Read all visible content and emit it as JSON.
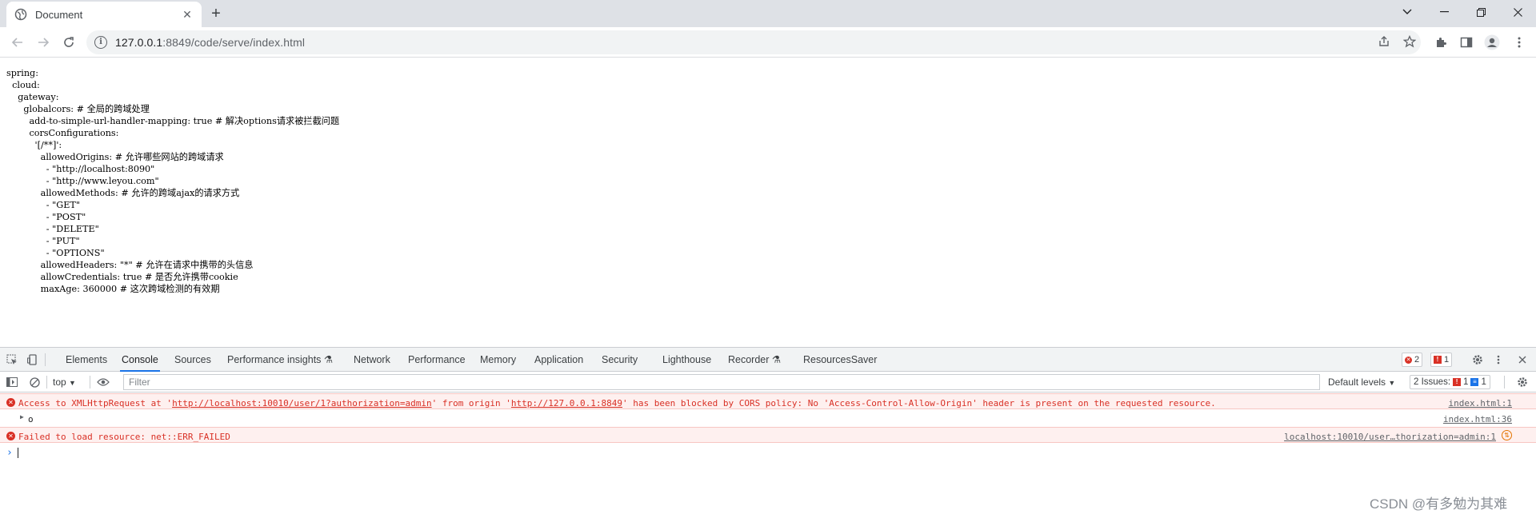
{
  "browser": {
    "tab_title": "Document",
    "new_tab_symbol": "+",
    "url_host": "127.0.0.1",
    "url_path": ":8849/code/serve/index.html"
  },
  "page": {
    "yaml_text": "spring:\n  cloud:\n    gateway:\n      globalcors: # 全局的跨域处理\n        add-to-simple-url-handler-mapping: true # 解决options请求被拦截问题\n        corsConfigurations:\n          '[/**]':\n            allowedOrigins: # 允许哪些网站的跨域请求\n              - \"http://localhost:8090\"\n              - \"http://www.leyou.com\"\n            allowedMethods: # 允许的跨域ajax的请求方式\n              - \"GET\"\n              - \"POST\"\n              - \"DELETE\"\n              - \"PUT\"\n              - \"OPTIONS\"\n            allowedHeaders: \"*\" # 允许在请求中携带的头信息\n            allowCredentials: true # 是否允许携带cookie\n            maxAge: 360000 # 这次跨域检测的有效期"
  },
  "devtools": {
    "tabs": [
      "Elements",
      "Console",
      "Sources",
      "Performance insights",
      "Network",
      "Performance",
      "Memory",
      "Application",
      "Security",
      "Lighthouse",
      "Recorder",
      "ResourcesSaver"
    ],
    "error_count": "2",
    "warning_count": "1",
    "context": "top",
    "filter_placeholder": "Filter",
    "levels": "Default levels",
    "issues_label": "2 Issues:",
    "issues_errors": "1",
    "issues_info": "1",
    "messages": [
      {
        "type": "error",
        "text_prefix": "Access to XMLHttpRequest at '",
        "link1": "http://localhost:10010/user/1?authorization=admin",
        "text_mid": "' from origin '",
        "link2": "http://127.0.0.1:8849",
        "text_suffix": "' has been blocked by CORS policy: No 'Access-Control-Allow-Origin' header is present on the requested resource.",
        "source": "index.html:1"
      },
      {
        "type": "log",
        "text": "o",
        "source": "index.html:36"
      },
      {
        "type": "error",
        "text": "Failed to load resource: net::ERR_FAILED",
        "source": "localhost:10010/user…thorization=admin:1"
      }
    ]
  },
  "watermark": "CSDN @有多勉为其难",
  "colors": {
    "error": "#d93025",
    "link_blue": "#1a73e8",
    "tabbar_bg": "#dee1e6"
  }
}
